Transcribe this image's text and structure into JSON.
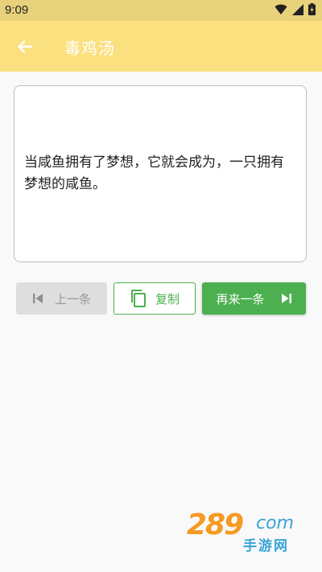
{
  "status_bar": {
    "time": "9:09",
    "icons": [
      "wifi-icon",
      "signal-icon",
      "battery-icon"
    ]
  },
  "app_bar": {
    "title": "毒鸡汤",
    "back_icon": "arrow-back-icon"
  },
  "quote": {
    "text": "当咸鱼拥有了梦想，它就会成为，一只拥有梦想的咸鱼。"
  },
  "actions": {
    "prev_label": "上一条",
    "prev_icon": "skip-previous-icon",
    "copy_label": "复制",
    "copy_icon": "copy-icon",
    "next_label": "再来一条",
    "next_icon": "skip-next-icon"
  },
  "watermark": {
    "number": "289",
    "domain_suffix": "com",
    "subtitle": "手游网"
  },
  "colors": {
    "app_bar": "#fbe07f",
    "status_bar": "#e7d17a",
    "accent_green": "#4caf50",
    "disabled_gray": "#dedede"
  }
}
